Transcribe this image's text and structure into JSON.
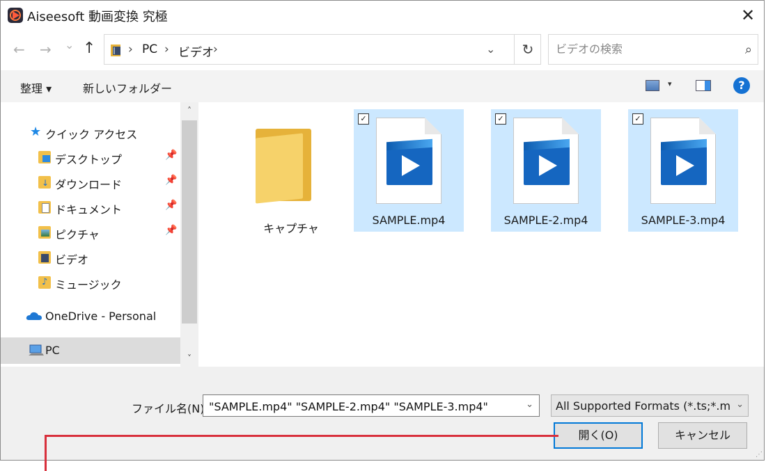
{
  "window": {
    "title": "Aiseesoft 動画変換 究極",
    "close": "✕"
  },
  "nav": {
    "back": "←",
    "forward": "→",
    "recent": "⌄",
    "up": "↑",
    "refresh": "↻"
  },
  "address": {
    "crumbs": [
      "PC",
      "ビデオ"
    ],
    "separator": "›",
    "dropdown": "⌄"
  },
  "search": {
    "placeholder": "ビデオの検索",
    "icon": "⌕"
  },
  "toolbar": {
    "organize": "整理 ▾",
    "new_folder": "新しいフォルダー",
    "view_drop": "▾",
    "help": "?"
  },
  "sidebar": {
    "items": [
      {
        "label": "クイック アクセス",
        "icon": "star-icon",
        "pinned": false
      },
      {
        "label": "デスクトップ",
        "icon": "folder-icon",
        "pinned": true
      },
      {
        "label": "ダウンロード",
        "icon": "download-folder-icon",
        "pinned": true
      },
      {
        "label": "ドキュメント",
        "icon": "document-folder-icon",
        "pinned": true
      },
      {
        "label": "ピクチャ",
        "icon": "picture-folder-icon",
        "pinned": true
      },
      {
        "label": "ビデオ",
        "icon": "video-folder-icon",
        "pinned": false
      },
      {
        "label": "ミュージック",
        "icon": "music-folder-icon",
        "pinned": false
      },
      {
        "label": "OneDrive - Personal",
        "icon": "cloud-icon",
        "pinned": false
      },
      {
        "label": "PC",
        "icon": "pc-icon",
        "pinned": false,
        "selected": true
      }
    ],
    "pin_glyph": "📌",
    "scroll_up": "˄",
    "scroll_down": "˅"
  },
  "files": [
    {
      "name": "キャプチャ",
      "type": "folder",
      "selected": false
    },
    {
      "name": "SAMPLE.mp4",
      "type": "video",
      "selected": true
    },
    {
      "name": "SAMPLE-2.mp4",
      "type": "video",
      "selected": true
    },
    {
      "name": "SAMPLE-3.mp4",
      "type": "video",
      "selected": true
    }
  ],
  "check_glyph": "✓",
  "bottom": {
    "filename_label": "ファイル名(N):",
    "filename_value": "\"SAMPLE.mp4\" \"SAMPLE-2.mp4\" \"SAMPLE-3.mp4\"",
    "filetype_value": "All Supported Formats (*.ts;*.mts",
    "dropdown": "⌄",
    "open_label": "開く(O)",
    "cancel_label": "キャンセル"
  },
  "colors": {
    "accent": "#0078d7",
    "selection": "#cce8ff",
    "annotation": "#d8303c"
  }
}
